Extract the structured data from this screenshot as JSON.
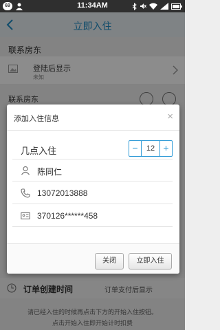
{
  "status_bar": {
    "badge": "69",
    "time": "11:34AM",
    "icons": [
      "person-icon",
      "bluetooth-icon",
      "mute-icon",
      "wifi-icon",
      "signal-icon",
      "battery-icon"
    ]
  },
  "header": {
    "title": "立即入住",
    "back_icon": "chevron-left-icon"
  },
  "page": {
    "section_title": "联系房东",
    "host": {
      "name": "登陆后显示",
      "status": "未知"
    },
    "contact_label": "联系房东",
    "order_time_label": "订单创建时间",
    "order_time_value": "订单支付后显示",
    "notice_line1": "请已经入住的时候再点击下方的开始入住按钮。",
    "notice_line2": "点击开始入住即开始计时扣费"
  },
  "dialog": {
    "title": "添加入住信息",
    "close_glyph": "×",
    "time_label": "几点入住",
    "hour_value": "12",
    "minus_glyph": "−",
    "plus_glyph": "+",
    "guest_name": "陈同仁",
    "phone": "13072013888",
    "id_number": "370126******458",
    "buttons": {
      "close": "关闭",
      "checkin": "立即入住"
    }
  },
  "colors": {
    "accent": "#1e8bc3",
    "stepper_border": "#2e9ad6",
    "status_bar": "#2f2f2f"
  }
}
